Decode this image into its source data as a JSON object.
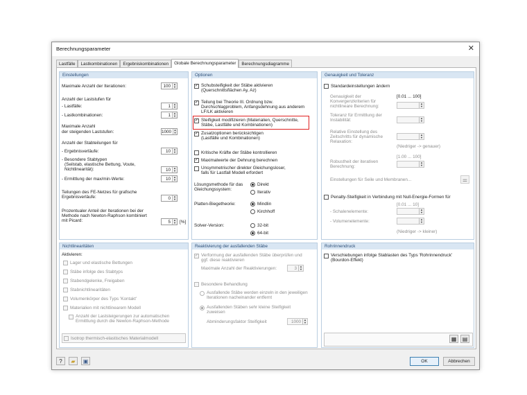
{
  "window": {
    "title": "Berechnungsparameter",
    "close_icon": "close-icon"
  },
  "tabs": [
    "Lastfälle",
    "Lastkombinationen",
    "Ergebniskombinationen",
    "Globale Berechnungsparameter",
    "Berechnungsdiagramme"
  ],
  "einstellungen": {
    "header": "Einstellungen",
    "max_iter_label": "Maximale Anzahl der Iterationen:",
    "max_iter": "100",
    "laststufen_label": "Anzahl der Laststufen für",
    "lastfaelle_label": "- Lastfälle:",
    "lastfaelle": "1",
    "lastkomb_label": "- Lastkombinationen:",
    "lastkomb": "1",
    "max_steigend_label1": "Maximale Anzahl",
    "max_steigend_label2": "der steigenden Laststufen:",
    "max_steigend": "1000",
    "stabteilungen_label": "Anzahl der Stabteilungen für",
    "ergebnisverlaeufe_label": "- Ergebnisverläufe:",
    "ergebnisverlaeufe": "10",
    "besondere_label1": "- Besondere Stabtypen",
    "besondere_label2": "(Seilstab, elastische Bettung, Voute,",
    "besondere_label3": "Nichtlinearität):",
    "besondere": "10",
    "maxmin_label": "- Ermittlung der max/min-Werte:",
    "maxmin": "10",
    "fe_label1": "Teilungen des FE-Netzes für grafische",
    "fe_label2": "Ergebnisverläufe:",
    "fe": "0",
    "proz_label1": "Prozentualer Anteil der Iterationen bei der",
    "proz_label2": "Methode nach Newton-Raphson kombiniert",
    "proz_label3": "mit Picard:",
    "proz": "5",
    "proz_unit": "[%]"
  },
  "optionen": {
    "header": "Optionen",
    "schub1": "Schubsteifigkeit der Stäbe aktivieren",
    "schub2": "(Querschnittsflächen Ay, Az)",
    "theorie1": "Teilung bei Theorie III. Ordnung bzw.",
    "theorie2": "Durchschlagproblem, Anfangsdehnung aus anderem",
    "theorie3": "LF/LK aktivieren",
    "steif1": "Steifigkeit modifizieren (Materialien, Querschnitte,",
    "steif2": "Stäbe, Lastfälle und Kombinationen)",
    "zusatz1": "Zusatzoptionen berücksichtigen",
    "zusatz2": "(Lastfälle und Kombinationen)",
    "kritisch": "Kritische Kräfte der Stäbe kontrollieren",
    "maxwerte": "Maximalwerte der Dehnung berechnen",
    "unsym1": "Unsymmetrischer direkter Gleichungsloser,",
    "unsym2": "falls für Lastfall Modell erfordert",
    "loesung1": "Lösungsmethode für das",
    "loesung2": "Gleichungssystem:",
    "direkt": "Direkt",
    "iterativ": "Iterativ",
    "platten": "Platten-Biegetheorie:",
    "mindlin": "Mindlin",
    "kirchhoff": "Kirchhoff",
    "solver": "Solver-Version:",
    "bit32": "32-bit",
    "bit64": "64-bit"
  },
  "genauigkeit": {
    "header": "Genauigkeit und Toleranz",
    "standard": "Standardeinstellungen ändern",
    "konv1": "Genauigkeit der",
    "konv2": "Konvergenzkriterien für",
    "konv3": "nichtlineare Berechnung:",
    "konv_range": "[0.01 ... 100]",
    "tol1": "Toleranz für Ermittlung der",
    "tol2": "Instabilität:",
    "rel1": "Relative Einstellung des",
    "rel2": "Zeitschritts für dynamische",
    "rel3": "Relaxation:",
    "niedriger_genauer": "(Niedriger -> genauer)",
    "rob_range": "[1.00 ... 100]",
    "rob1": "Robustheit der iterativen",
    "rob2": "Berechnung:",
    "seile": "Einstellungen für Seile und Membranen...",
    "penalty": "Penalty-Steifigkeit in Verbindung mit Null-Energie-Formen für",
    "pen_range": "[0.01 ... 10]",
    "schalen": "- Schalenelemente:",
    "volumen": "- Volumenelemente:",
    "niedriger_kleiner": "(Niedriger -> kleiner)"
  },
  "nichtlin": {
    "header": "Nichtlinearitäten",
    "aktivieren": "Aktivieren:",
    "items": [
      "Lager und elastische Bettungen",
      "Stäbe infolge des Stabtyps",
      "Stabendgelenke, Freigaben",
      "Stabnichtlinearitäten",
      "Volumenkörper des Typs 'Kontakt'",
      "Materialien mit nichtlinearem Modell"
    ],
    "anzahl1": "Anzahl der Laststeigerungen zur automatischen",
    "anzahl2": "Ermittlung durch die  Newton-Raphson-Methode",
    "isotrop": "Isotrop thermisch-elastisches Materialmodell"
  },
  "reaktiv": {
    "header": "Reaktivierung der ausfallenden Stäbe",
    "verf1": "Verformung der ausfallenden Stäbe überprüfen und",
    "verf2": "ggf. diese reaktivieren",
    "maxanzahl": "Maximale Anzahl der Reaktivierungen:",
    "maxanzahl_val": "3",
    "besondere": "Besondere Behandlung",
    "ausf1": "Ausfallende Stäbe werden einzeln in den jeweiligen",
    "ausf2": "Iterationen nacheinander entfernt",
    "ausf3": "Ausfallenden Stäben sehr kleine Steifigkeit",
    "ausf4": "zuweisen",
    "abm": "Abminderungsfaktor Steifigkeit",
    "abm_val": "1000"
  },
  "rohr": {
    "header": "Rohrinnendruck",
    "verschieb1": "Verschiebungen infolge Stablasten des Typs 'Rohrinnendruck'",
    "verschieb2": "(Bourdon-Effekt)"
  },
  "footer": {
    "ok": "OK",
    "abbrechen": "Abbrechen"
  }
}
